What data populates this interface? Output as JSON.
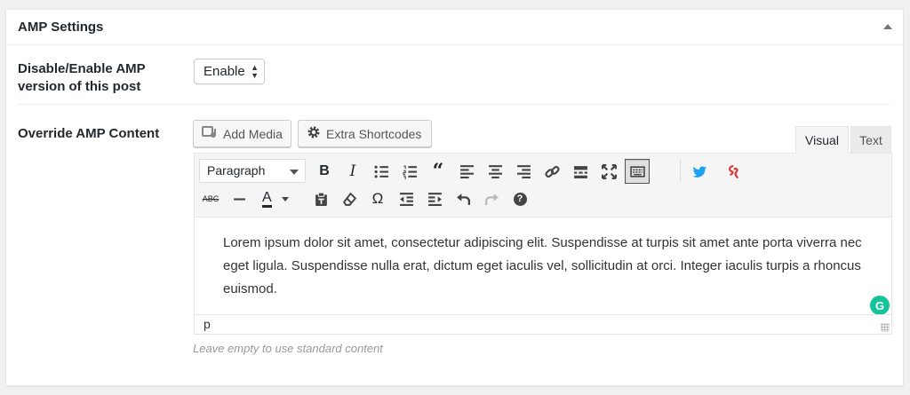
{
  "metabox": {
    "title": "AMP Settings"
  },
  "status_row": {
    "label": "Disable/Enable AMP version of this post",
    "selected": "Enable"
  },
  "content_row": {
    "label": "Override AMP Content"
  },
  "media_buttons": {
    "add_media": "Add Media",
    "extra_shortcodes": "Extra Shortcodes"
  },
  "tabs": {
    "visual": "Visual",
    "text": "Text",
    "active": "Visual"
  },
  "toolbar": {
    "format": "Paragraph",
    "row1_icons": [
      "bold-icon",
      "italic-icon",
      "bullet-list-icon",
      "numbered-list-icon",
      "blockquote-icon",
      "align-left-icon",
      "align-center-icon",
      "align-right-icon",
      "link-icon",
      "read-more-icon",
      "fullscreen-icon",
      "toolbar-toggle-icon",
      "twitter-icon",
      "shortcode-icon"
    ],
    "row2_icons": [
      "strikethrough-icon",
      "horizontal-line-icon",
      "text-color-icon",
      "paste-text-icon",
      "clear-formatting-icon",
      "special-character-icon",
      "outdent-icon",
      "indent-icon",
      "undo-icon",
      "redo-icon",
      "help-icon"
    ],
    "bold": "B",
    "italic": "I",
    "strike": "ABC",
    "text_color": "A",
    "omega": "Ω",
    "help": "?"
  },
  "editor": {
    "content": "Lorem ipsum dolor sit amet, consectetur adipiscing elit. Suspendisse at turpis sit amet ante porta viverra nec eget ligula. Suspendisse nulla erat, dictum eget iaculis vel, sollicitudin at orci. Integer iaculis turpis a rhoncus euismod.",
    "path": "p",
    "grammarly": "G"
  },
  "hint": "Leave empty to use standard content",
  "colors": {
    "twitter": "#1da1f2",
    "shortcode": "#dd3333",
    "grammarly": "#15c39a"
  }
}
